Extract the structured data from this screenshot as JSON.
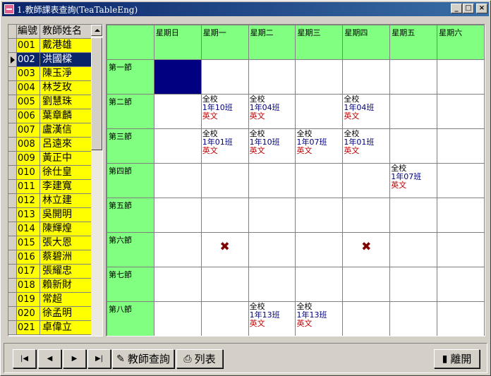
{
  "window": {
    "title": "1.教師課表查詢(TeaTableEng)",
    "minimize_icon": "minimize-icon",
    "maximize_icon": "maximize-icon",
    "close_icon": "close-icon"
  },
  "teacher_list": {
    "header_code": "編號",
    "header_name": "教師姓名",
    "selected_index": 1,
    "rows": [
      {
        "code": "001",
        "name": "戴港雄"
      },
      {
        "code": "002",
        "name": "洪國樑"
      },
      {
        "code": "003",
        "name": "陳玉淨"
      },
      {
        "code": "004",
        "name": "林芝玫"
      },
      {
        "code": "005",
        "name": "劉慧珠"
      },
      {
        "code": "006",
        "name": "葉章麟"
      },
      {
        "code": "007",
        "name": "盧漢信"
      },
      {
        "code": "008",
        "name": "呂遠來"
      },
      {
        "code": "009",
        "name": "黃正中"
      },
      {
        "code": "010",
        "name": "徐仕皇"
      },
      {
        "code": "011",
        "name": "李建寬"
      },
      {
        "code": "012",
        "name": "林立建"
      },
      {
        "code": "013",
        "name": "吳開明"
      },
      {
        "code": "014",
        "name": "陳輝煌"
      },
      {
        "code": "015",
        "name": "張大恩"
      },
      {
        "code": "016",
        "name": "蔡碧洲"
      },
      {
        "code": "017",
        "name": "張耀忠"
      },
      {
        "code": "018",
        "name": "賴新財"
      },
      {
        "code": "019",
        "name": "常超"
      },
      {
        "code": "020",
        "name": "徐孟明"
      },
      {
        "code": "021",
        "name": "卓偉立"
      }
    ]
  },
  "schedule": {
    "days": [
      "星期日",
      "星期一",
      "星期二",
      "星期三",
      "星期四",
      "星期五",
      "星期六"
    ],
    "periods": [
      "第一節",
      "第二節",
      "第三節",
      "第四節",
      "第五節",
      "第六節",
      "第七節",
      "第八節"
    ],
    "selected_cell": {
      "period": 0,
      "day": 0
    },
    "entries": [
      {
        "period": 1,
        "day": 1,
        "lines": [
          "全校",
          "1年10班",
          "英文"
        ]
      },
      {
        "period": 1,
        "day": 2,
        "lines": [
          "全校",
          "1年04班",
          "英文"
        ]
      },
      {
        "period": 1,
        "day": 4,
        "lines": [
          "全校",
          "1年04班",
          "英文"
        ]
      },
      {
        "period": 2,
        "day": 1,
        "lines": [
          "全校",
          "1年01班",
          "英文"
        ]
      },
      {
        "period": 2,
        "day": 2,
        "lines": [
          "全校",
          "1年10班",
          "英文"
        ]
      },
      {
        "period": 2,
        "day": 3,
        "lines": [
          "全校",
          "1年07班",
          "英文"
        ]
      },
      {
        "period": 2,
        "day": 4,
        "lines": [
          "全校",
          "1年01班",
          "英文"
        ]
      },
      {
        "period": 3,
        "day": 5,
        "lines": [
          "全校",
          "1年07班",
          "英文"
        ]
      },
      {
        "period": 7,
        "day": 2,
        "lines": [
          "全校",
          "1年13班",
          "英文"
        ]
      },
      {
        "period": 7,
        "day": 3,
        "lines": [
          "全校",
          "1年13班",
          "英文"
        ]
      }
    ],
    "blocked": [
      {
        "period": 5,
        "day": 1
      },
      {
        "period": 5,
        "day": 4
      }
    ],
    "blocked_glyph": "✖"
  },
  "toolbar": {
    "first_icon": "first-record-icon",
    "prev_icon": "previous-record-icon",
    "next_icon": "next-record-icon",
    "last_icon": "last-record-icon",
    "query_label": "教師查詢",
    "list_label": "列表",
    "exit_label": "離開"
  }
}
